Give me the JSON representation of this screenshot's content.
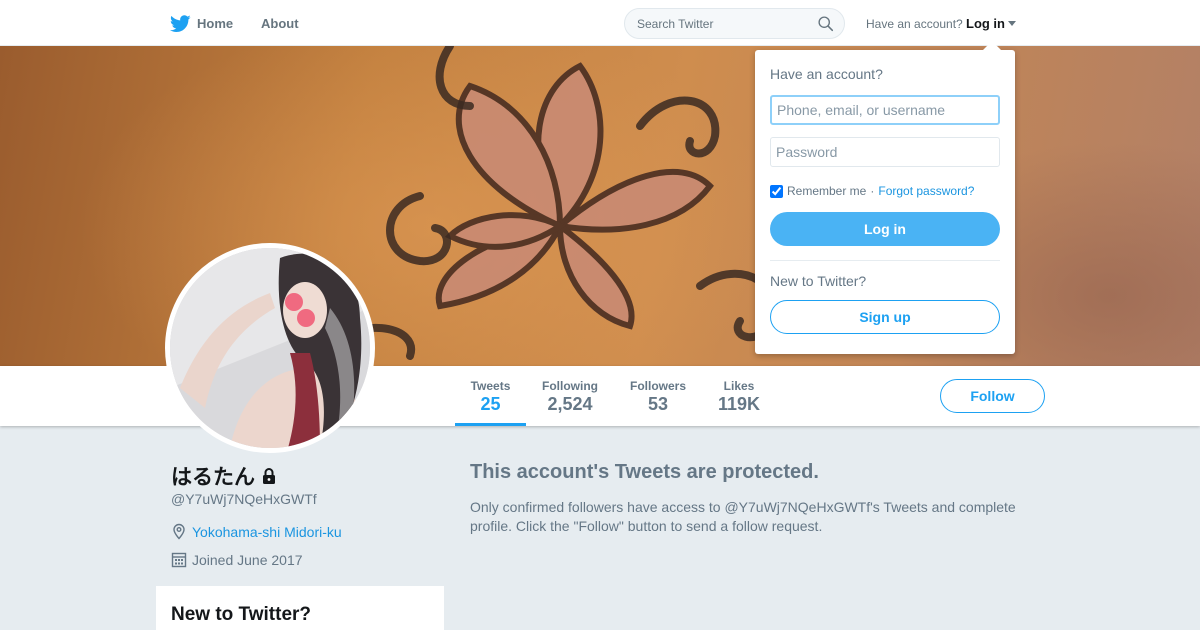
{
  "topnav": {
    "home_label": "Home",
    "about_label": "About",
    "search_placeholder": "Search Twitter",
    "have_account": "Have an account?",
    "login_label": "Log in",
    "icon_home": "twitter-bird-icon",
    "icon_search": "search-icon",
    "icon_caret": "caret-down-icon"
  },
  "profile_nav": {
    "stats": [
      {
        "label": "Tweets",
        "value": "25"
      },
      {
        "label": "Following",
        "value": "2,524"
      },
      {
        "label": "Followers",
        "value": "53"
      },
      {
        "label": "Likes",
        "value": "119K"
      }
    ],
    "active_stat": "Tweets",
    "follow_label": "Follow"
  },
  "profile": {
    "name": "はるたん",
    "screen_name": "@Y7uWj7NQeHxGWTf",
    "location": "Yokohama-shi Midori-ku",
    "joined": "Joined June 2017",
    "icons": {
      "protected": "lock-icon",
      "location": "location-pin-icon",
      "joined": "calendar-icon"
    }
  },
  "new_card": {
    "title": "New to Twitter?"
  },
  "protected": {
    "title": "This account's Tweets are protected.",
    "body": "Only confirmed followers have access to @Y7uWj7NQeHxGWTf's Tweets and complete profile. Click the \"Follow\" button to send a follow request."
  },
  "login_dropdown": {
    "heading": "Have an account?",
    "username_placeholder": "Phone, email, or username",
    "password_placeholder": "Password",
    "remember_label": "Remember me",
    "separator": "·",
    "forgot_label": "Forgot password?",
    "login_button": "Log in",
    "new_heading": "New to Twitter?",
    "signup_button": "Sign up",
    "remember_checked": true
  },
  "colors": {
    "brand": "#1da1f2",
    "link": "#1b95e0",
    "login_button": "#4ab3f4",
    "page_background": "#e6ecf0",
    "muted_text": "#657786"
  }
}
